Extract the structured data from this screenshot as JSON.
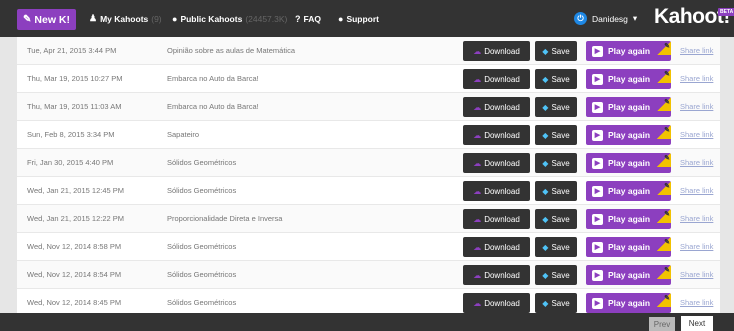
{
  "nav": {
    "new_label": "New K!",
    "my_kahoots_label": "My Kahoots",
    "my_kahoots_count": "(9)",
    "public_kahoots_label": "Public Kahoots",
    "public_kahoots_count": "(24457.3K)",
    "faq_label": "FAQ",
    "support_label": "Support",
    "user_label": "Danidesg",
    "logo_text": "Kahoot!",
    "beta_label": "BETA"
  },
  "table": {
    "download_label": "Download",
    "save_label": "Save",
    "play_label": "Play again",
    "share_label": "Share link",
    "rows": [
      {
        "date": "Tue, Apr 21, 2015 3:44 PM",
        "title": "Opinião sobre as aulas de Matemática"
      },
      {
        "date": "Thu, Mar 19, 2015 10:27 PM",
        "title": "Embarca no Auto da Barca!"
      },
      {
        "date": "Thu, Mar 19, 2015 11:03 AM",
        "title": "Embarca no Auto da Barca!"
      },
      {
        "date": "Sun, Feb 8, 2015 3:34 PM",
        "title": "Sapateiro"
      },
      {
        "date": "Fri, Jan 30, 2015 4:40 PM",
        "title": "Sólidos Geométricos"
      },
      {
        "date": "Wed, Jan 21, 2015 12:45 PM",
        "title": "Sólidos Geométricos"
      },
      {
        "date": "Wed, Jan 21, 2015 12:22 PM",
        "title": "Proporcionalidade Direta e Inversa"
      },
      {
        "date": "Wed, Nov 12, 2014 8:58 PM",
        "title": "Sólidos Geométricos"
      },
      {
        "date": "Wed, Nov 12, 2014 8:54 PM",
        "title": "Sólidos Geométricos"
      },
      {
        "date": "Wed, Nov 12, 2014 8:45 PM",
        "title": "Sólidos Geométricos"
      }
    ]
  },
  "pagination": {
    "prev_label": "Prev",
    "next_label": "Next"
  },
  "colors": {
    "brand_purple": "#8c3fbf",
    "nav_dark": "#333333",
    "play_corner_yellow": "#f2c200",
    "save_icon_blue": "#4fc3f7"
  }
}
